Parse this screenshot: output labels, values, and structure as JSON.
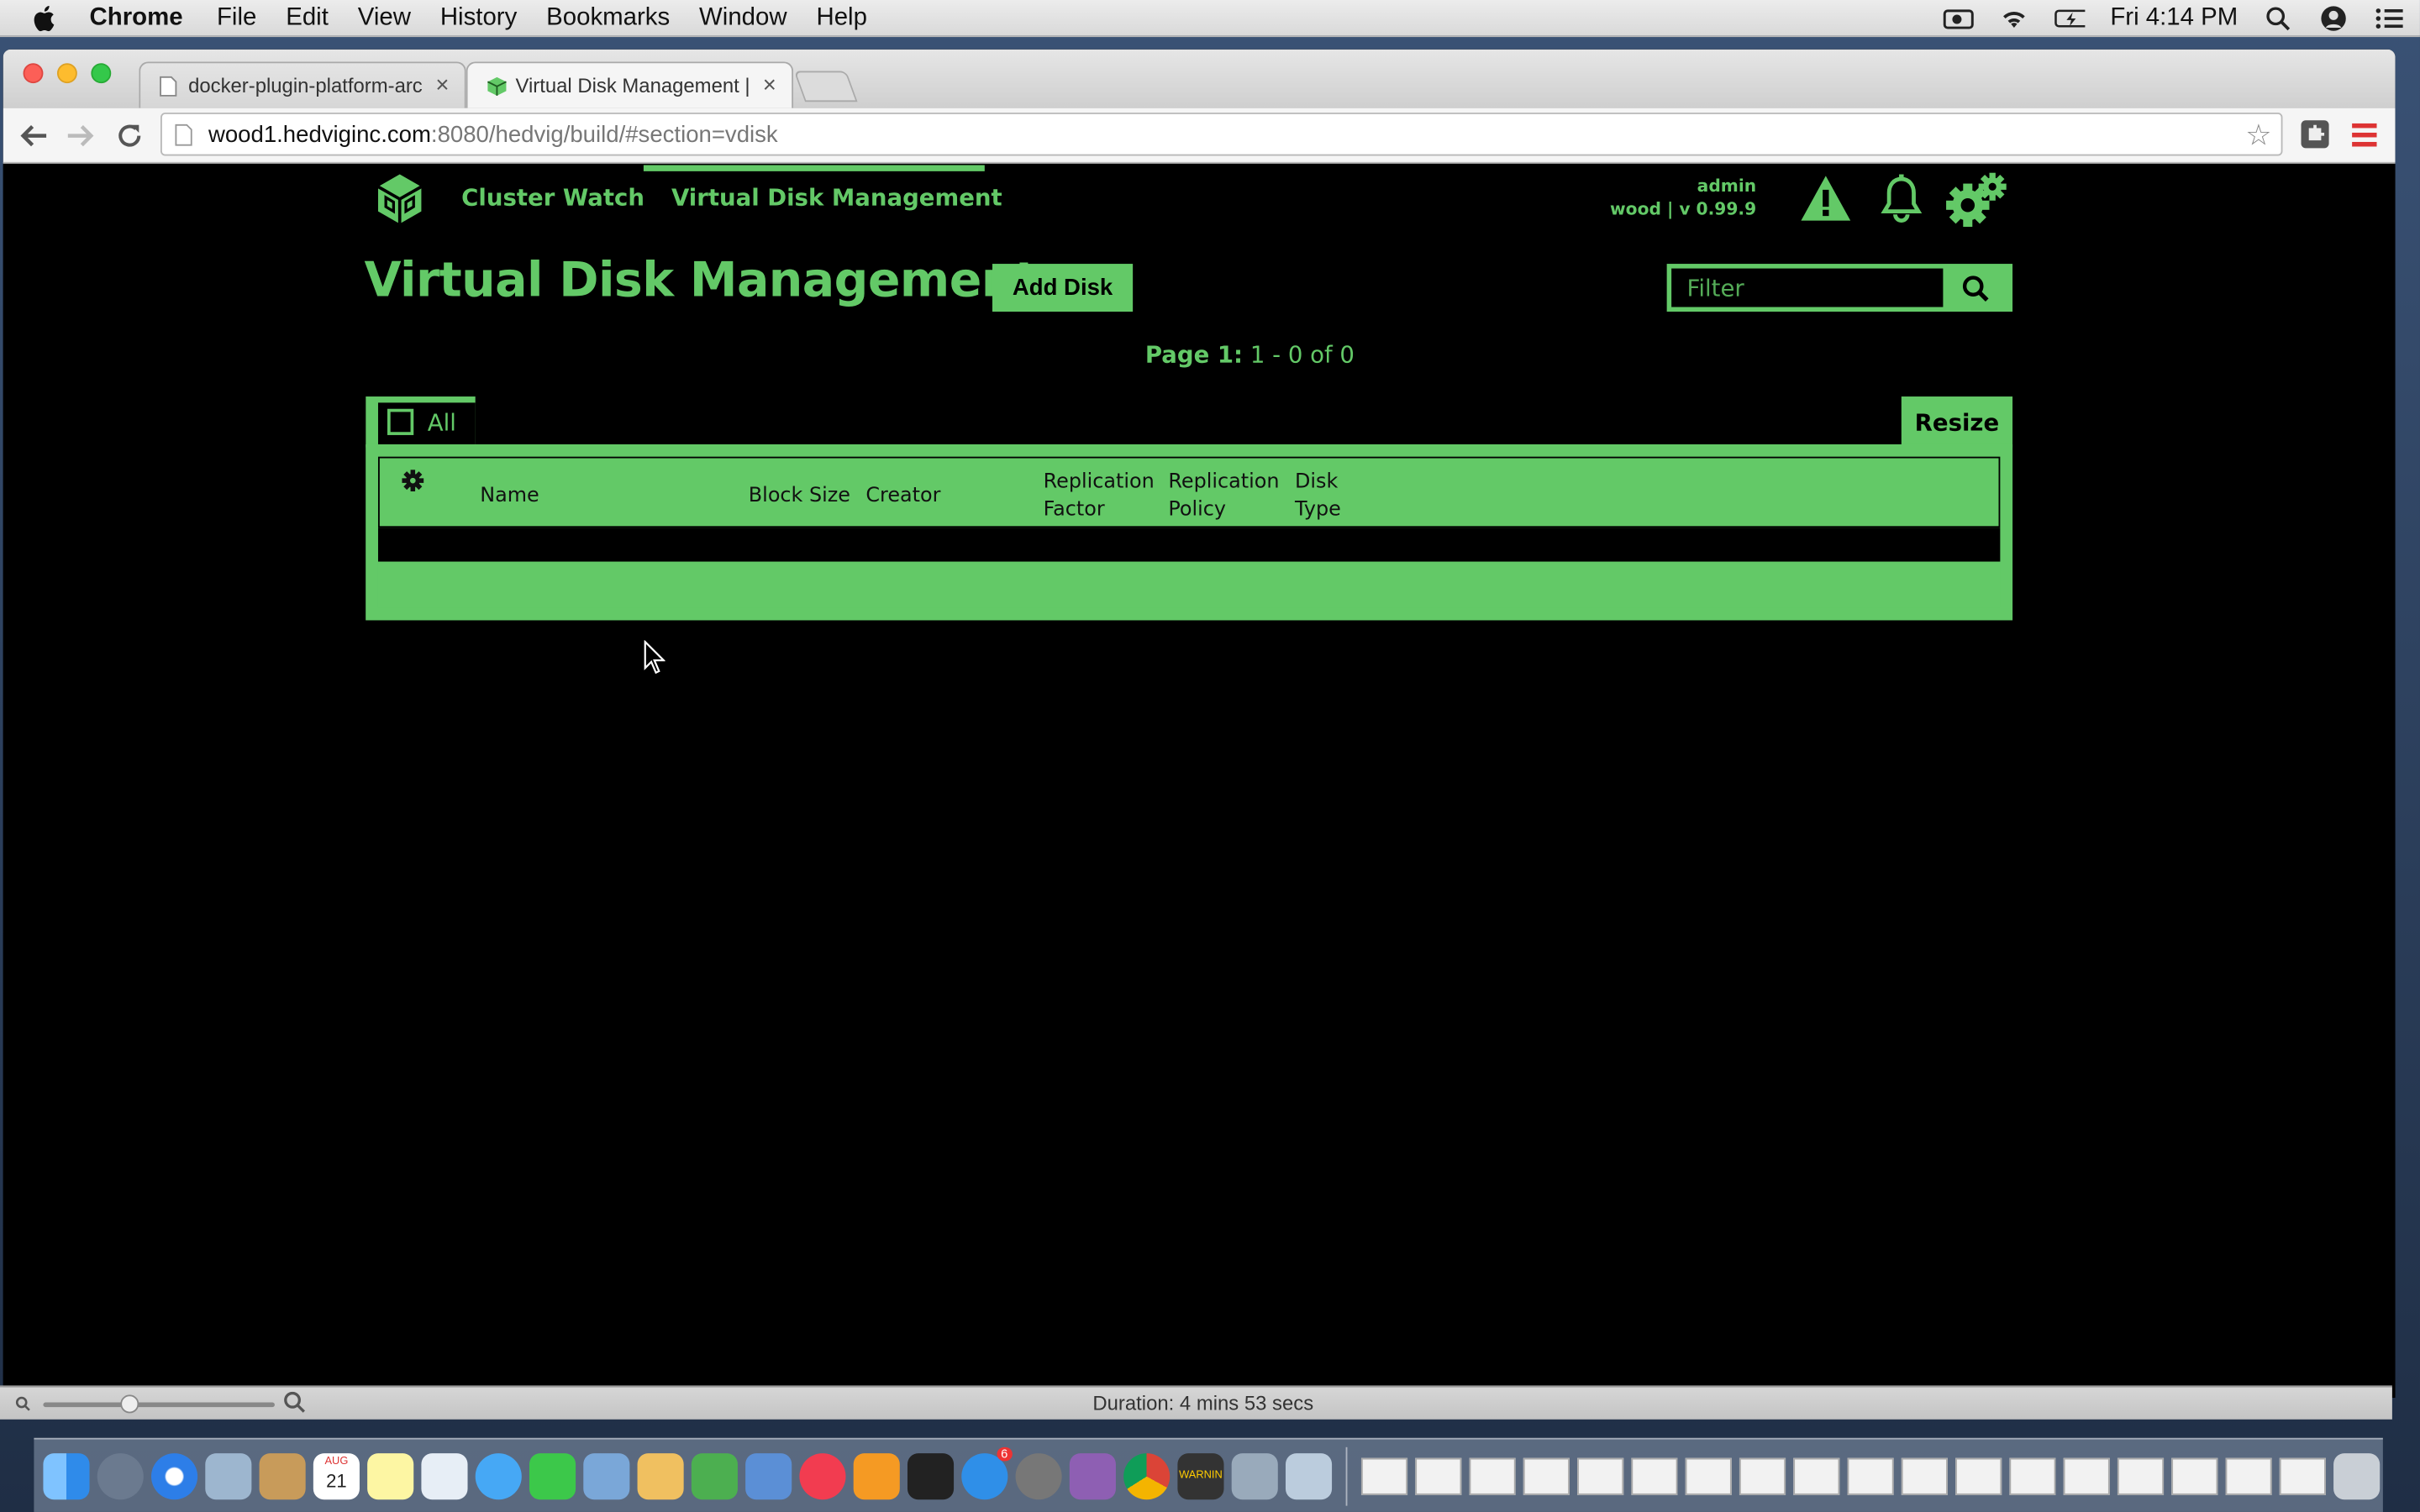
{
  "menubar": {
    "app_name": "Chrome",
    "items": [
      "File",
      "Edit",
      "View",
      "History",
      "Bookmarks",
      "Window",
      "Help"
    ],
    "clock": "Fri 4:14 PM"
  },
  "browser": {
    "tabs": [
      {
        "title": "docker-plugin-platform-arc"
      },
      {
        "title": "Virtual Disk Management |"
      }
    ],
    "url_host": "wood1.hedviginc.com",
    "url_path": ":8080/hedvig/build/#section=vdisk"
  },
  "app": {
    "nav": {
      "cluster_watch": "Cluster Watch",
      "vdisk": "Virtual Disk Management"
    },
    "user": {
      "name": "admin",
      "cluster_version": "wood | v 0.99.9"
    },
    "title": "Virtual Disk Management",
    "add_disk_label": "Add Disk",
    "filter_placeholder": "Filter",
    "pager": {
      "page_label": "Page 1:",
      "range": "1 - 0 of 0"
    },
    "select_all_label": "All",
    "resize_label": "Resize",
    "columns": {
      "name": "Name",
      "block_size": "Block Size",
      "creator": "Creator",
      "replication_factor_1": "Replication",
      "replication_factor_2": "Factor",
      "replication_policy_1": "Replication",
      "replication_policy_2": "Policy",
      "disk_type_1": "Disk",
      "disk_type_2": "Type"
    },
    "accent_color": "#63c967"
  },
  "statusbar": {
    "duration": "Duration: 4 mins 53 secs"
  },
  "dock": {
    "calendar_day": "21",
    "calendar_month": "AUG",
    "appstore_badge": "6",
    "console_text": "WARNIN"
  }
}
